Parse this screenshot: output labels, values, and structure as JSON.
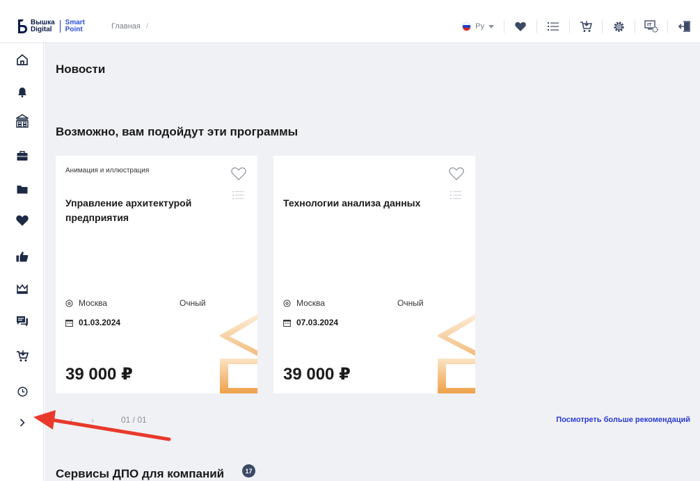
{
  "header": {
    "logo": {
      "line1": "Вышка",
      "line2": "Digital",
      "line3": "Smart",
      "line4": "Point"
    },
    "breadcrumb": {
      "home": "Главная",
      "separator": "/"
    },
    "language": "Ру",
    "icons": [
      "heart-icon",
      "list-icon",
      "cart-icon",
      "gear-icon",
      "it-settings-icon",
      "logout-icon"
    ]
  },
  "sidebar": {
    "items": [
      "home-icon",
      "bell-icon",
      "university-icon",
      "briefcase-icon",
      "folder-icon",
      "heart-icon",
      "thumbs-up-icon",
      "crown-icon",
      "chat-icon",
      "cart-icon",
      "clock-icon",
      "expand-icon"
    ]
  },
  "main": {
    "news_title": "Новости",
    "programs_title": "Возможно, вам подойдут эти программы",
    "cards": [
      {
        "category": "Анимация и иллюстрация",
        "title": "Управление архитектурой предприятия",
        "city": "Москва",
        "format": "Очный",
        "date": "01.03.2024",
        "price": "39 000 ₽"
      },
      {
        "category": "",
        "title": "Технологии анализа данных",
        "city": "Москва",
        "format": "Очный",
        "date": "07.03.2024",
        "price": "39 000 ₽"
      }
    ],
    "pager": {
      "prev": "‹",
      "next": "›",
      "pages": "01 / 01"
    },
    "more_link": "Посмотреть больше рекомендаций",
    "services_title": "Сервисы ДПО для компаний",
    "services_count": "17"
  },
  "colors": {
    "accent_blue": "#2a3bd6",
    "annotation_red": "#e8392b",
    "card_deco_orange": "#f0a24a",
    "background": "#f0f1f4"
  }
}
